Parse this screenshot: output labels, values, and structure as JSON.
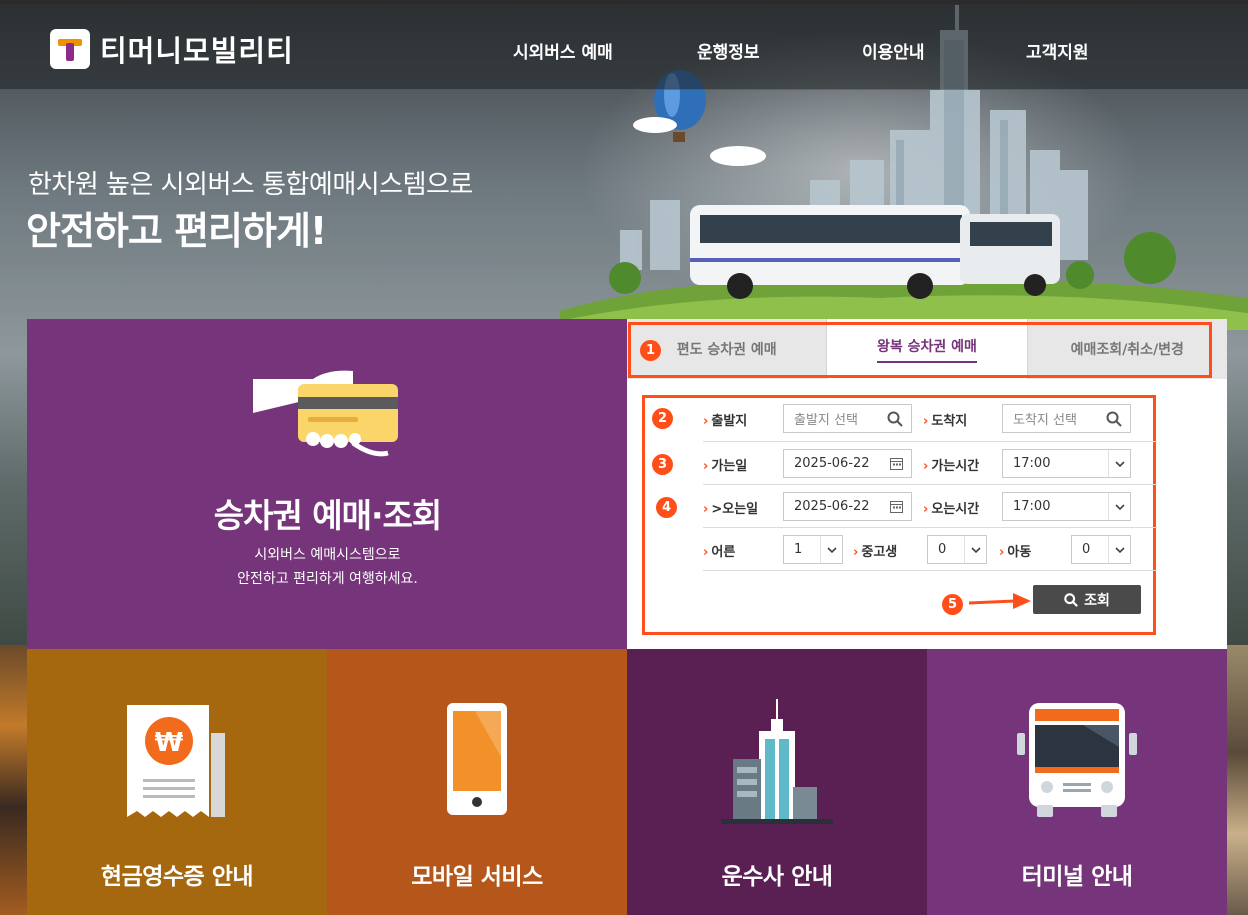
{
  "header": {
    "logo_text": "티머니모빌리티",
    "nav": [
      "시외버스 예매",
      "운행정보",
      "이용안내",
      "고객지원"
    ]
  },
  "hero": {
    "subtitle": "한차원 높은 시외버스 통합예매시스템으로",
    "title": "안전하고 편리하게!"
  },
  "ticket_panel": {
    "title": "승차권 예매·조회",
    "desc_line1": "시외버스 예매시스템으로",
    "desc_line2": "안전하고 편리하게 여행하세요."
  },
  "booking": {
    "tabs": [
      {
        "label": "편도 승차권 예매",
        "active": false
      },
      {
        "label": "왕복 승차권 예매",
        "active": true
      },
      {
        "label": "예매조회/취소/변경",
        "active": false
      }
    ],
    "step_numbers": [
      "1",
      "2",
      "3",
      "4",
      "5"
    ],
    "departure": {
      "label": "출발지",
      "placeholder": "출발지 선택"
    },
    "arrival": {
      "label": "도착지",
      "placeholder": "도착지 선택"
    },
    "go_date": {
      "label": "가는일",
      "value": "2025-06-22"
    },
    "go_time": {
      "label": "가는시간",
      "value": "17:00"
    },
    "return_date": {
      "label": ">오는일",
      "value": "2025-06-22"
    },
    "return_time": {
      "label": "오는시간",
      "value": "17:00"
    },
    "adult": {
      "label": "어른",
      "value": "1"
    },
    "youth": {
      "label": "중고생",
      "value": "0"
    },
    "child": {
      "label": "아동",
      "value": "0"
    },
    "search_label": "조회"
  },
  "tiles": [
    {
      "label": "현금영수증 안내",
      "color": "#a5680f",
      "icon": "receipt-won-icon"
    },
    {
      "label": "모바일 서비스",
      "color": "#b5561a",
      "icon": "smartphone-icon"
    },
    {
      "label": "운수사 안내",
      "color": "#5a2054",
      "icon": "building-icon"
    },
    {
      "label": "터미널 안내",
      "color": "#76347a",
      "icon": "bus-front-icon"
    }
  ],
  "colors": {
    "brand_purple": "#76347a",
    "accent_orange": "#ff4e1a"
  }
}
